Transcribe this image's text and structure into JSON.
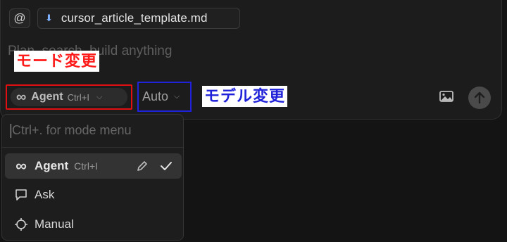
{
  "composer": {
    "at_symbol": "@",
    "file_chip": {
      "icon": "download-arrow-icon",
      "filename": "cursor_article_template.md"
    },
    "placeholder": "Plan, search, build anything",
    "mode_selector": {
      "icon": "infinity-icon",
      "label": "Agent",
      "shortcut": "Ctrl+I"
    },
    "model_selector": {
      "label": "Auto"
    },
    "image_icon": "image-icon",
    "send_icon": "arrow-up-icon"
  },
  "annotations": {
    "mode_change": "モード変更",
    "model_change": "モデル変更",
    "mode_color": "#ff1a1a",
    "model_color": "#1f22d9"
  },
  "mode_menu": {
    "search_placeholder": "Ctrl+. for mode menu",
    "items": [
      {
        "icon": "infinity-icon",
        "label": "Agent",
        "shortcut": "Ctrl+I",
        "selected": true
      },
      {
        "icon": "chat-bubble-icon",
        "label": "Ask"
      },
      {
        "icon": "crosshair-icon",
        "label": "Manual"
      }
    ]
  }
}
